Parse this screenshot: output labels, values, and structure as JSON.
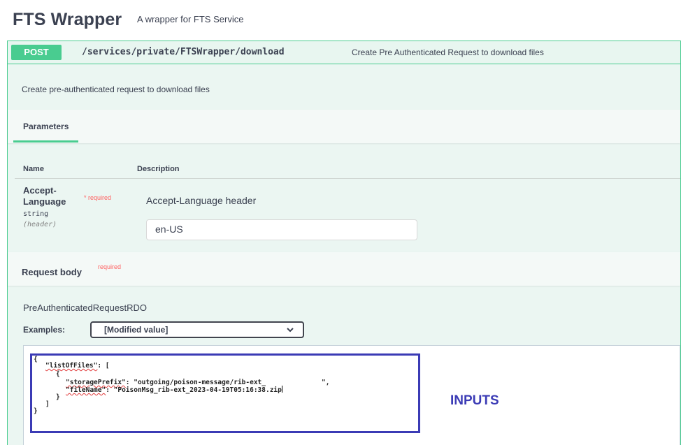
{
  "header": {
    "title": "FTS Wrapper",
    "subtitle": "A wrapper for FTS Service"
  },
  "operation": {
    "method": "POST",
    "path": "/services/private/FTSWrapper/download",
    "summary": "Create Pre Authenticated Request to download files",
    "description": "Create pre-authenticated request to download files"
  },
  "parameters": {
    "tab_label": "Parameters",
    "col_name": "Name",
    "col_description": "Description",
    "items": [
      {
        "name_line1": "Accept-",
        "name_line2": "Language",
        "required_mark": "* required",
        "type": "string",
        "in": "(header)",
        "description": "Accept-Language header",
        "value": "en-US"
      }
    ]
  },
  "request_body": {
    "title": "Request body",
    "required_mark": "required",
    "schema_name": "PreAuthenticatedRequestRDO",
    "examples_label": "Examples:",
    "examples_selected": "[Modified value]",
    "json_lines": {
      "l1": "{",
      "l2_key": "\"listOfFiles\"",
      "l2_rest": ": [",
      "l3": "{",
      "l4_key": "\"storagePrefix\"",
      "l4_rest": ": \"outgoing/poison-message/rib-ext_",
      "l4_end": "\",",
      "l5_key": "\"fileName\"",
      "l5_rest": ": \"PoisonMsg_rib-ext_2023-04-19T05:16:38.zip",
      "l6": "}",
      "l7": "]",
      "l8": "}"
    },
    "annotation": "INPUTS"
  },
  "colors": {
    "post_green": "#49cc90",
    "op_background": "#ebf6f2",
    "annotation_blue": "#3b3bb5",
    "required_red": "#ff6060"
  }
}
